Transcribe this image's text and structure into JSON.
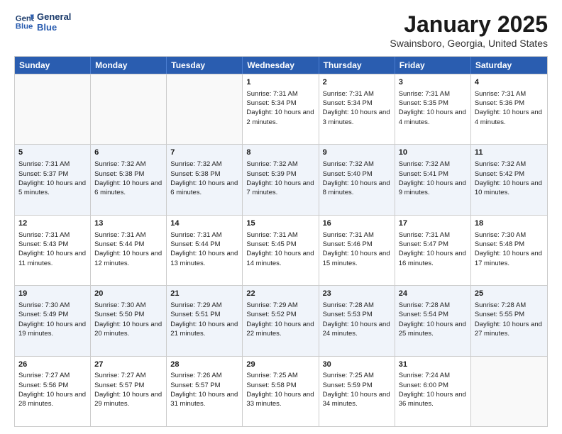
{
  "header": {
    "logo": {
      "line1": "General",
      "line2": "Blue"
    },
    "title": "January 2025",
    "location": "Swainsboro, Georgia, United States"
  },
  "calendar": {
    "days_of_week": [
      "Sunday",
      "Monday",
      "Tuesday",
      "Wednesday",
      "Thursday",
      "Friday",
      "Saturday"
    ],
    "rows": [
      [
        {
          "day": "",
          "empty": true
        },
        {
          "day": "",
          "empty": true
        },
        {
          "day": "",
          "empty": true
        },
        {
          "day": "1",
          "line1": "Sunrise: 7:31 AM",
          "line2": "Sunset: 5:34 PM",
          "line3": "Daylight: 10 hours and 2 minutes."
        },
        {
          "day": "2",
          "line1": "Sunrise: 7:31 AM",
          "line2": "Sunset: 5:34 PM",
          "line3": "Daylight: 10 hours and 3 minutes."
        },
        {
          "day": "3",
          "line1": "Sunrise: 7:31 AM",
          "line2": "Sunset: 5:35 PM",
          "line3": "Daylight: 10 hours and 4 minutes."
        },
        {
          "day": "4",
          "line1": "Sunrise: 7:31 AM",
          "line2": "Sunset: 5:36 PM",
          "line3": "Daylight: 10 hours and 4 minutes."
        }
      ],
      [
        {
          "day": "5",
          "line1": "Sunrise: 7:31 AM",
          "line2": "Sunset: 5:37 PM",
          "line3": "Daylight: 10 hours and 5 minutes."
        },
        {
          "day": "6",
          "line1": "Sunrise: 7:32 AM",
          "line2": "Sunset: 5:38 PM",
          "line3": "Daylight: 10 hours and 6 minutes."
        },
        {
          "day": "7",
          "line1": "Sunrise: 7:32 AM",
          "line2": "Sunset: 5:38 PM",
          "line3": "Daylight: 10 hours and 6 minutes."
        },
        {
          "day": "8",
          "line1": "Sunrise: 7:32 AM",
          "line2": "Sunset: 5:39 PM",
          "line3": "Daylight: 10 hours and 7 minutes."
        },
        {
          "day": "9",
          "line1": "Sunrise: 7:32 AM",
          "line2": "Sunset: 5:40 PM",
          "line3": "Daylight: 10 hours and 8 minutes."
        },
        {
          "day": "10",
          "line1": "Sunrise: 7:32 AM",
          "line2": "Sunset: 5:41 PM",
          "line3": "Daylight: 10 hours and 9 minutes."
        },
        {
          "day": "11",
          "line1": "Sunrise: 7:32 AM",
          "line2": "Sunset: 5:42 PM",
          "line3": "Daylight: 10 hours and 10 minutes."
        }
      ],
      [
        {
          "day": "12",
          "line1": "Sunrise: 7:31 AM",
          "line2": "Sunset: 5:43 PM",
          "line3": "Daylight: 10 hours and 11 minutes."
        },
        {
          "day": "13",
          "line1": "Sunrise: 7:31 AM",
          "line2": "Sunset: 5:44 PM",
          "line3": "Daylight: 10 hours and 12 minutes."
        },
        {
          "day": "14",
          "line1": "Sunrise: 7:31 AM",
          "line2": "Sunset: 5:44 PM",
          "line3": "Daylight: 10 hours and 13 minutes."
        },
        {
          "day": "15",
          "line1": "Sunrise: 7:31 AM",
          "line2": "Sunset: 5:45 PM",
          "line3": "Daylight: 10 hours and 14 minutes."
        },
        {
          "day": "16",
          "line1": "Sunrise: 7:31 AM",
          "line2": "Sunset: 5:46 PM",
          "line3": "Daylight: 10 hours and 15 minutes."
        },
        {
          "day": "17",
          "line1": "Sunrise: 7:31 AM",
          "line2": "Sunset: 5:47 PM",
          "line3": "Daylight: 10 hours and 16 minutes."
        },
        {
          "day": "18",
          "line1": "Sunrise: 7:30 AM",
          "line2": "Sunset: 5:48 PM",
          "line3": "Daylight: 10 hours and 17 minutes."
        }
      ],
      [
        {
          "day": "19",
          "line1": "Sunrise: 7:30 AM",
          "line2": "Sunset: 5:49 PM",
          "line3": "Daylight: 10 hours and 19 minutes."
        },
        {
          "day": "20",
          "line1": "Sunrise: 7:30 AM",
          "line2": "Sunset: 5:50 PM",
          "line3": "Daylight: 10 hours and 20 minutes."
        },
        {
          "day": "21",
          "line1": "Sunrise: 7:29 AM",
          "line2": "Sunset: 5:51 PM",
          "line3": "Daylight: 10 hours and 21 minutes."
        },
        {
          "day": "22",
          "line1": "Sunrise: 7:29 AM",
          "line2": "Sunset: 5:52 PM",
          "line3": "Daylight: 10 hours and 22 minutes."
        },
        {
          "day": "23",
          "line1": "Sunrise: 7:28 AM",
          "line2": "Sunset: 5:53 PM",
          "line3": "Daylight: 10 hours and 24 minutes."
        },
        {
          "day": "24",
          "line1": "Sunrise: 7:28 AM",
          "line2": "Sunset: 5:54 PM",
          "line3": "Daylight: 10 hours and 25 minutes."
        },
        {
          "day": "25",
          "line1": "Sunrise: 7:28 AM",
          "line2": "Sunset: 5:55 PM",
          "line3": "Daylight: 10 hours and 27 minutes."
        }
      ],
      [
        {
          "day": "26",
          "line1": "Sunrise: 7:27 AM",
          "line2": "Sunset: 5:56 PM",
          "line3": "Daylight: 10 hours and 28 minutes."
        },
        {
          "day": "27",
          "line1": "Sunrise: 7:27 AM",
          "line2": "Sunset: 5:57 PM",
          "line3": "Daylight: 10 hours and 29 minutes."
        },
        {
          "day": "28",
          "line1": "Sunrise: 7:26 AM",
          "line2": "Sunset: 5:57 PM",
          "line3": "Daylight: 10 hours and 31 minutes."
        },
        {
          "day": "29",
          "line1": "Sunrise: 7:25 AM",
          "line2": "Sunset: 5:58 PM",
          "line3": "Daylight: 10 hours and 33 minutes."
        },
        {
          "day": "30",
          "line1": "Sunrise: 7:25 AM",
          "line2": "Sunset: 5:59 PM",
          "line3": "Daylight: 10 hours and 34 minutes."
        },
        {
          "day": "31",
          "line1": "Sunrise: 7:24 AM",
          "line2": "Sunset: 6:00 PM",
          "line3": "Daylight: 10 hours and 36 minutes."
        },
        {
          "day": "",
          "empty": true
        }
      ]
    ]
  }
}
